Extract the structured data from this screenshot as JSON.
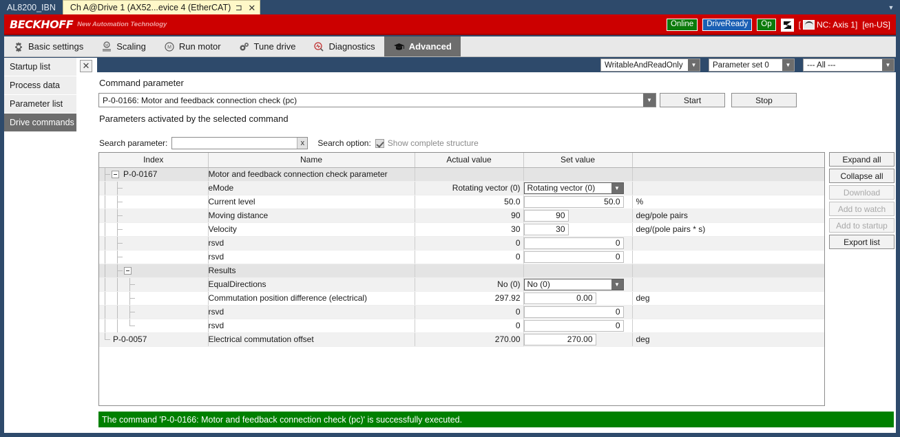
{
  "titlebar": {
    "inactive_tab": "AL8200_IBN",
    "active_tab": "Ch A@Drive 1 (AX52...evice 4 (EtherCAT)",
    "pin_icon": "pin-icon",
    "close_icon": "close-icon",
    "overflow_icon": "chevron-down-icon"
  },
  "banner": {
    "brand": "BECKHOFF",
    "tagline": "New Automation Technology",
    "badges": [
      {
        "label": "Online",
        "color": "#0b7a0b"
      },
      {
        "label": "DriveReady",
        "color": "#1a5fb4"
      },
      {
        "label": "Op",
        "color": "#0b7a0b"
      }
    ],
    "tool_icon": "terminal-icon",
    "nc_open": "[",
    "nc_label": "NC: Axis 1]",
    "locale": "[en-US]"
  },
  "tabs": [
    {
      "label": "Basic settings",
      "icon": "gear-icon",
      "active": false
    },
    {
      "label": "Scaling",
      "icon": "scaling-icon",
      "active": false
    },
    {
      "label": "Run motor",
      "icon": "motor-icon",
      "active": false
    },
    {
      "label": "Tune drive",
      "icon": "gears-icon",
      "active": false
    },
    {
      "label": "Diagnostics",
      "icon": "magnifier-pulse-icon",
      "active": false
    },
    {
      "label": "Advanced",
      "icon": "graduation-cap-icon",
      "active": true
    }
  ],
  "sidebar": {
    "close_icon": "close-icon",
    "items": [
      {
        "label": "Startup list",
        "active": false
      },
      {
        "label": "Process data",
        "active": false
      },
      {
        "label": "Parameter list",
        "active": false
      },
      {
        "label": "Drive commands",
        "active": true
      }
    ]
  },
  "filters": [
    {
      "value": "WritableAndReadOnly"
    },
    {
      "value": "Parameter set 0"
    },
    {
      "value": "--- All ---"
    }
  ],
  "main": {
    "section_title": "Command parameter",
    "command_value": "P-0-0166: Motor and feedback connection check (pc)",
    "start_label": "Start",
    "stop_label": "Stop",
    "sub_title": "Parameters activated by the selected command",
    "search_label": "Search parameter:",
    "search_value": "",
    "search_placeholder": "",
    "search_clear": "x",
    "option_label": "Search option:",
    "option_checked": true,
    "option_text": "Show complete structure"
  },
  "table": {
    "headers": [
      "Index",
      "Name",
      "Actual value",
      "Set value",
      ""
    ],
    "rows": [
      {
        "depth": 0,
        "expander": "minus",
        "index": "P-0-0167",
        "name": "Motor and feedback connection check parameter",
        "actual": "",
        "actual_unit": "",
        "set_kind": "none",
        "set": "",
        "set_unit": "",
        "band": "grp"
      },
      {
        "depth": 1,
        "expander": "",
        "index": "",
        "name": "eMode",
        "actual": "Rotating vector (0)",
        "actual_unit": "",
        "set_kind": "combo",
        "set": "Rotating vector (0)",
        "set_unit": "",
        "band": "odd"
      },
      {
        "depth": 1,
        "expander": "",
        "index": "",
        "name": "Current level",
        "actual": "50.0",
        "actual_unit": "%",
        "set_kind": "wide",
        "set": "50.0",
        "set_unit": "%",
        "band": "even"
      },
      {
        "depth": 1,
        "expander": "",
        "index": "",
        "name": "Moving distance",
        "actual": "90",
        "actual_unit": "deg/pole pairs",
        "set_kind": "narrow",
        "set": "90",
        "set_unit": "deg/pole pairs",
        "band": "odd"
      },
      {
        "depth": 1,
        "expander": "",
        "index": "",
        "name": "Velocity",
        "actual": "30",
        "actual_unit": "deg/(pole pairs * s)",
        "set_kind": "narrow",
        "set": "30",
        "set_unit": "deg/(pole pairs * s)",
        "band": "even"
      },
      {
        "depth": 1,
        "expander": "",
        "index": "",
        "name": "rsvd",
        "actual": "0",
        "actual_unit": "",
        "set_kind": "wide",
        "set": "0",
        "set_unit": "",
        "band": "odd"
      },
      {
        "depth": 1,
        "expander": "",
        "index": "",
        "name": "rsvd",
        "actual": "0",
        "actual_unit": "",
        "set_kind": "wide",
        "set": "0",
        "set_unit": "",
        "band": "even"
      },
      {
        "depth": 1,
        "expander": "minus",
        "index": "",
        "name": "Results",
        "actual": "",
        "actual_unit": "",
        "set_kind": "none",
        "set": "",
        "set_unit": "",
        "band": "grp"
      },
      {
        "depth": 2,
        "expander": "",
        "index": "",
        "name": "EqualDirections",
        "actual": "No (0)",
        "actual_unit": "",
        "set_kind": "combo",
        "set": "No (0)",
        "set_unit": "",
        "band": "odd"
      },
      {
        "depth": 2,
        "expander": "",
        "index": "",
        "name": "Commutation position difference (electrical)",
        "actual": "297.92",
        "actual_unit": "deg",
        "set_kind": "mid",
        "set": "0.00",
        "set_unit": "deg",
        "band": "even"
      },
      {
        "depth": 2,
        "expander": "",
        "index": "",
        "name": "rsvd",
        "actual": "0",
        "actual_unit": "",
        "set_kind": "wide",
        "set": "0",
        "set_unit": "",
        "band": "odd"
      },
      {
        "depth": 2,
        "expander": "",
        "index": "",
        "name": "rsvd",
        "actual": "0",
        "actual_unit": "",
        "set_kind": "wide",
        "set": "0",
        "set_unit": "",
        "band": "even"
      },
      {
        "depth": 0,
        "expander": "",
        "index": "P-0-0057",
        "name": "Electrical commutation offset",
        "actual": "270.00",
        "actual_unit": "deg",
        "set_kind": "mid",
        "set": "270.00",
        "set_unit": "deg",
        "band": "odd"
      }
    ]
  },
  "right_buttons": [
    {
      "label": "Expand all",
      "disabled": false
    },
    {
      "label": "Collapse all",
      "disabled": false
    },
    {
      "label": "Download",
      "disabled": true
    },
    {
      "label": "Add to watch",
      "disabled": true
    },
    {
      "label": "Add to startup",
      "disabled": true
    },
    {
      "label": "Export list",
      "disabled": false
    }
  ],
  "statusbar": {
    "message": "The command 'P-0-0166: Motor and feedback connection check (pc)' is successfully executed.",
    "color": "#008000"
  }
}
